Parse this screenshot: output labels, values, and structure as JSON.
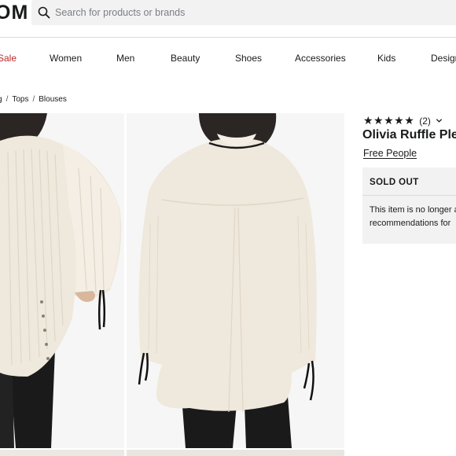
{
  "header": {
    "logo_text": "OM",
    "search": {
      "placeholder": "Search for products or brands",
      "value": "",
      "icon": "search-icon"
    }
  },
  "nav": {
    "items": [
      {
        "label": "Sale",
        "color": "#b7292a"
      },
      {
        "label": "Women"
      },
      {
        "label": "Men"
      },
      {
        "label": "Beauty"
      },
      {
        "label": "Shoes"
      },
      {
        "label": "Accessories"
      },
      {
        "label": "Kids"
      },
      {
        "label": "Design"
      }
    ]
  },
  "breadcrumb": {
    "items": [
      "g",
      "Tops",
      "Blouses"
    ],
    "separator": "/"
  },
  "product": {
    "rating": {
      "stars": "★★★★★",
      "count": "(2)",
      "icon": "chevron-down-icon"
    },
    "title": "Olivia Ruffle Ple",
    "brand": "Free People",
    "status": {
      "heading": "SOLD OUT",
      "message_line1": "This item is no longer a",
      "message_line2": "recommendations for"
    }
  },
  "gallery": {
    "images": [
      {
        "alt": "blouse-side-view-image"
      },
      {
        "alt": "blouse-back-view-image"
      }
    ]
  },
  "colors": {
    "accent_sale": "#b7292a",
    "text": "#191a1b",
    "panel": "#f2f2f3"
  }
}
